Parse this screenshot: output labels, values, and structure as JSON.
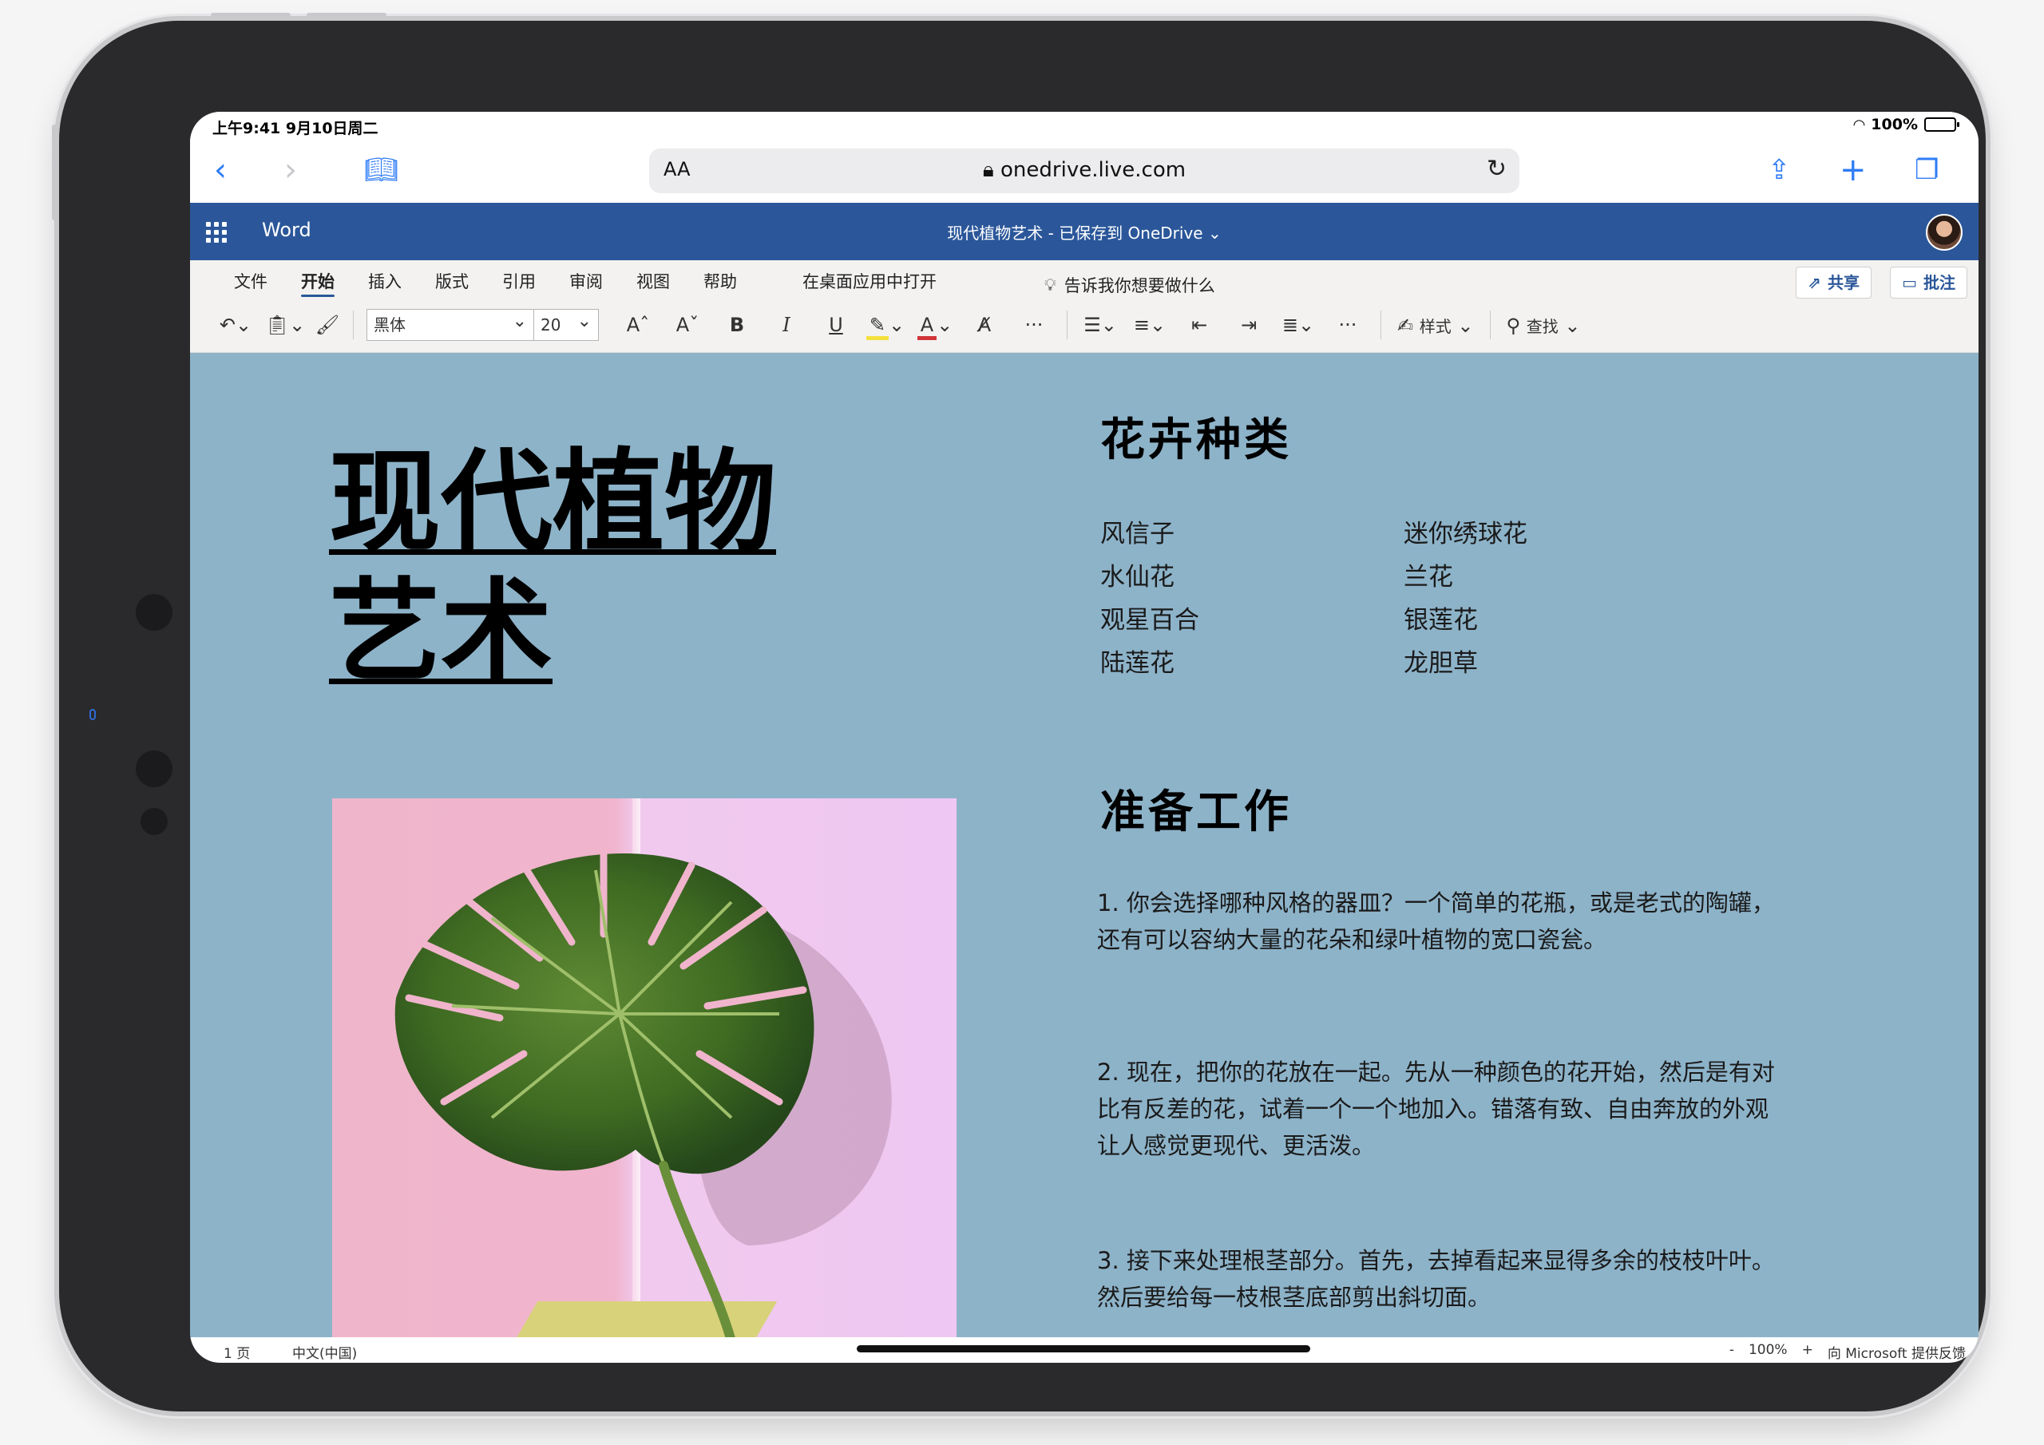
{
  "status": {
    "time": "上午9:41  9月10日周二",
    "battery": "100%"
  },
  "safari": {
    "text_size": "AA",
    "url": "onedrive.live.com",
    "icons": [
      "back-icon",
      "forward-icon",
      "bookmarks-icon",
      "lock-icon",
      "reload-icon",
      "share-icon",
      "new-tab-icon",
      "tabs-icon"
    ]
  },
  "word": {
    "app_name": "Word",
    "doc_status": "现代植物艺术 - 已保存到 OneDrive ⌄"
  },
  "ribbon": {
    "tabs": [
      "文件",
      "开始",
      "插入",
      "版式",
      "引用",
      "审阅",
      "视图",
      "帮助"
    ],
    "active_tab": "开始",
    "open_desktop": "在桌面应用中打开",
    "tell_me": "告诉我你想要做什么",
    "share": "共享",
    "comments": "批注",
    "font_name": "黑体",
    "font_size": "20",
    "styles": "样式",
    "find": "查找",
    "highlight_color": "#f4e03c",
    "font_color": "#d13438"
  },
  "document": {
    "title_line1": "现代植物",
    "title_line2": "艺术",
    "section1_heading": "花卉种类",
    "flowers_col1": [
      "风信子",
      "水仙花",
      "观星百合",
      "陆莲花"
    ],
    "flowers_col2": [
      "迷你绣球花",
      "兰花",
      "银莲花",
      "龙胆草"
    ],
    "section2_heading": "准备工作",
    "steps": [
      "1. 你会选择哪种风格的器皿？一个简单的花瓶，或是老式的陶罐，还有可以容纳大量的花朵和绿叶植物的宽口瓷瓮。",
      "2. 现在，把你的花放在一起。先从一种颜色的花开始，然后是有对比有反差的花，试着一个一个地加入。错落有致、自由奔放的外观让人感觉更现代、更活泼。",
      "3. 接下来处理根茎部分。首先，去掉看起来显得多余的枝枝叶叶。然后要给每一枝根茎底部剪出斜切面。"
    ],
    "background_color": "#8db3c9"
  },
  "statusbar": {
    "page": "1 页",
    "language": "中文(中国)",
    "zoom_out": "-",
    "zoom": "100%",
    "zoom_in": "+",
    "feedback": "向 Microsoft 提供反馈"
  }
}
